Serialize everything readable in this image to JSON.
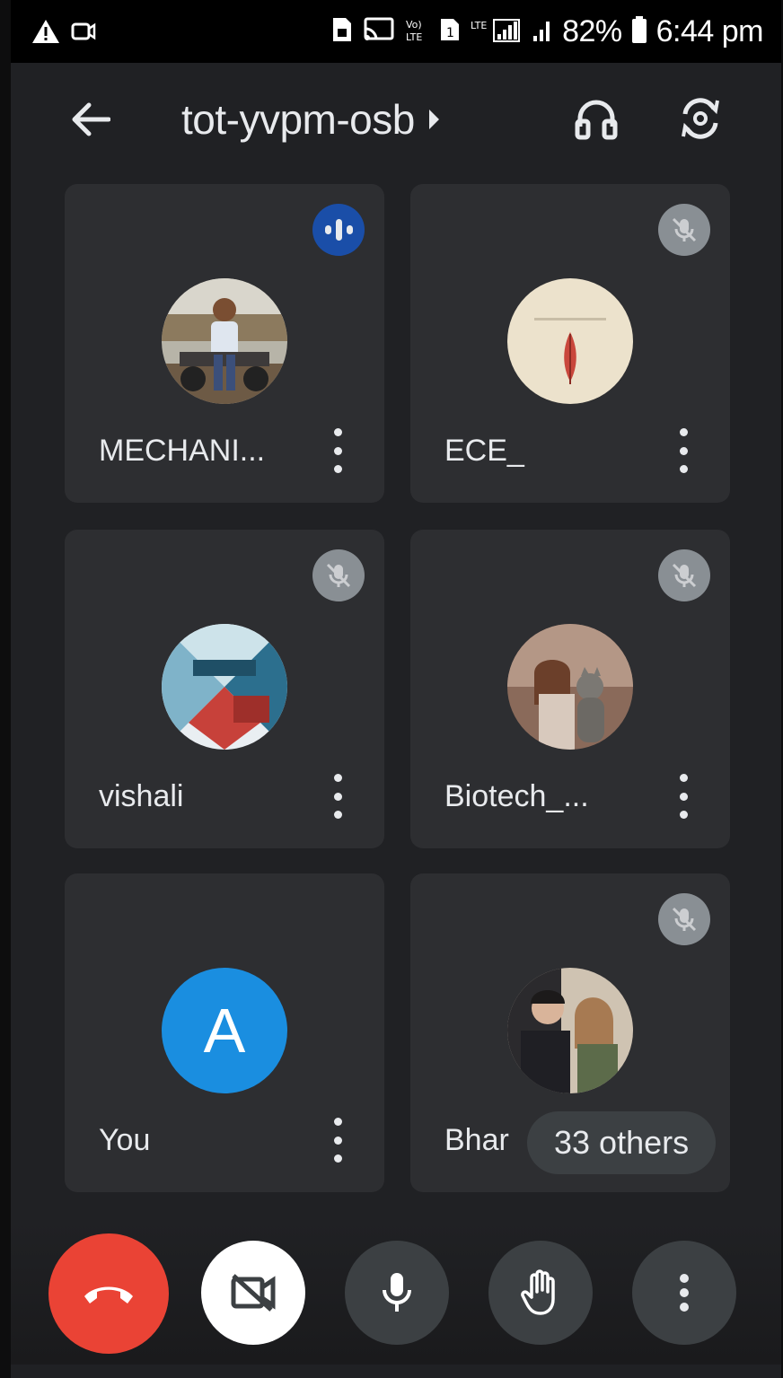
{
  "status_bar": {
    "battery": "82%",
    "time": "6:44 pm"
  },
  "header": {
    "meeting_code": "tot-yvpm-osb"
  },
  "tiles": [
    {
      "name": "MECHANI...",
      "state": "speaking"
    },
    {
      "name": "ECE_",
      "state": "muted"
    },
    {
      "name": "vishali",
      "state": "muted"
    },
    {
      "name": "Biotech_...",
      "state": "muted"
    },
    {
      "name": "You",
      "avatar_letter": "A",
      "state": "self"
    },
    {
      "name": "Bhar",
      "state": "muted",
      "others_label": "33 others"
    }
  ],
  "colors": {
    "background": "#202124",
    "tile": "#2d2e31",
    "end_call": "#ea4335",
    "speaking": "#1a4ea8",
    "self_avatar": "#1a8ee0"
  },
  "icons": [
    "back-arrow-icon",
    "caret-right-icon",
    "headphones-icon",
    "switch-camera-icon",
    "mic-off-icon",
    "speaking-icon",
    "end-call-icon",
    "video-off-icon",
    "mic-icon",
    "raise-hand-icon",
    "more-vert-icon"
  ]
}
